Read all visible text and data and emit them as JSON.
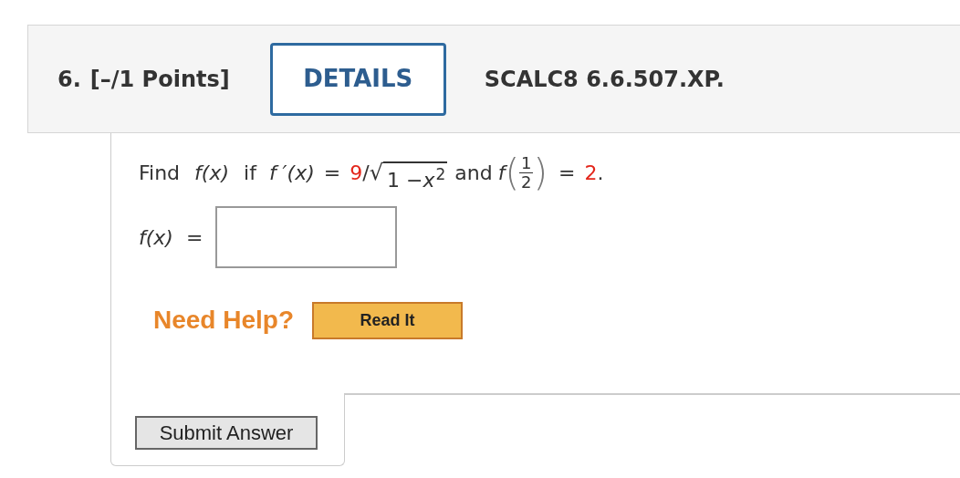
{
  "header": {
    "number": "6.",
    "points": "[–/1 Points]",
    "details_button": "DETAILS",
    "code": "SCALC8 6.6.507.XP."
  },
  "question": {
    "find": "Find",
    "fx": "f(x)",
    "if": "if",
    "fprime": "f ′(x)",
    "eq": "=",
    "numerator": "9",
    "slash": "/",
    "root": "√",
    "radicand": "1 − ",
    "var": "x",
    "exponent": "2",
    "and": "and",
    "f": "f",
    "open": "(",
    "frac_num": "1",
    "frac_den": "2",
    "close": ")",
    "eq2": "=",
    "value": "2",
    "period": "."
  },
  "answer": {
    "label": "f(x)",
    "equals": "="
  },
  "help": {
    "label": "Need Help?",
    "buttons": [
      "Read It"
    ]
  },
  "submit": "Submit Answer"
}
